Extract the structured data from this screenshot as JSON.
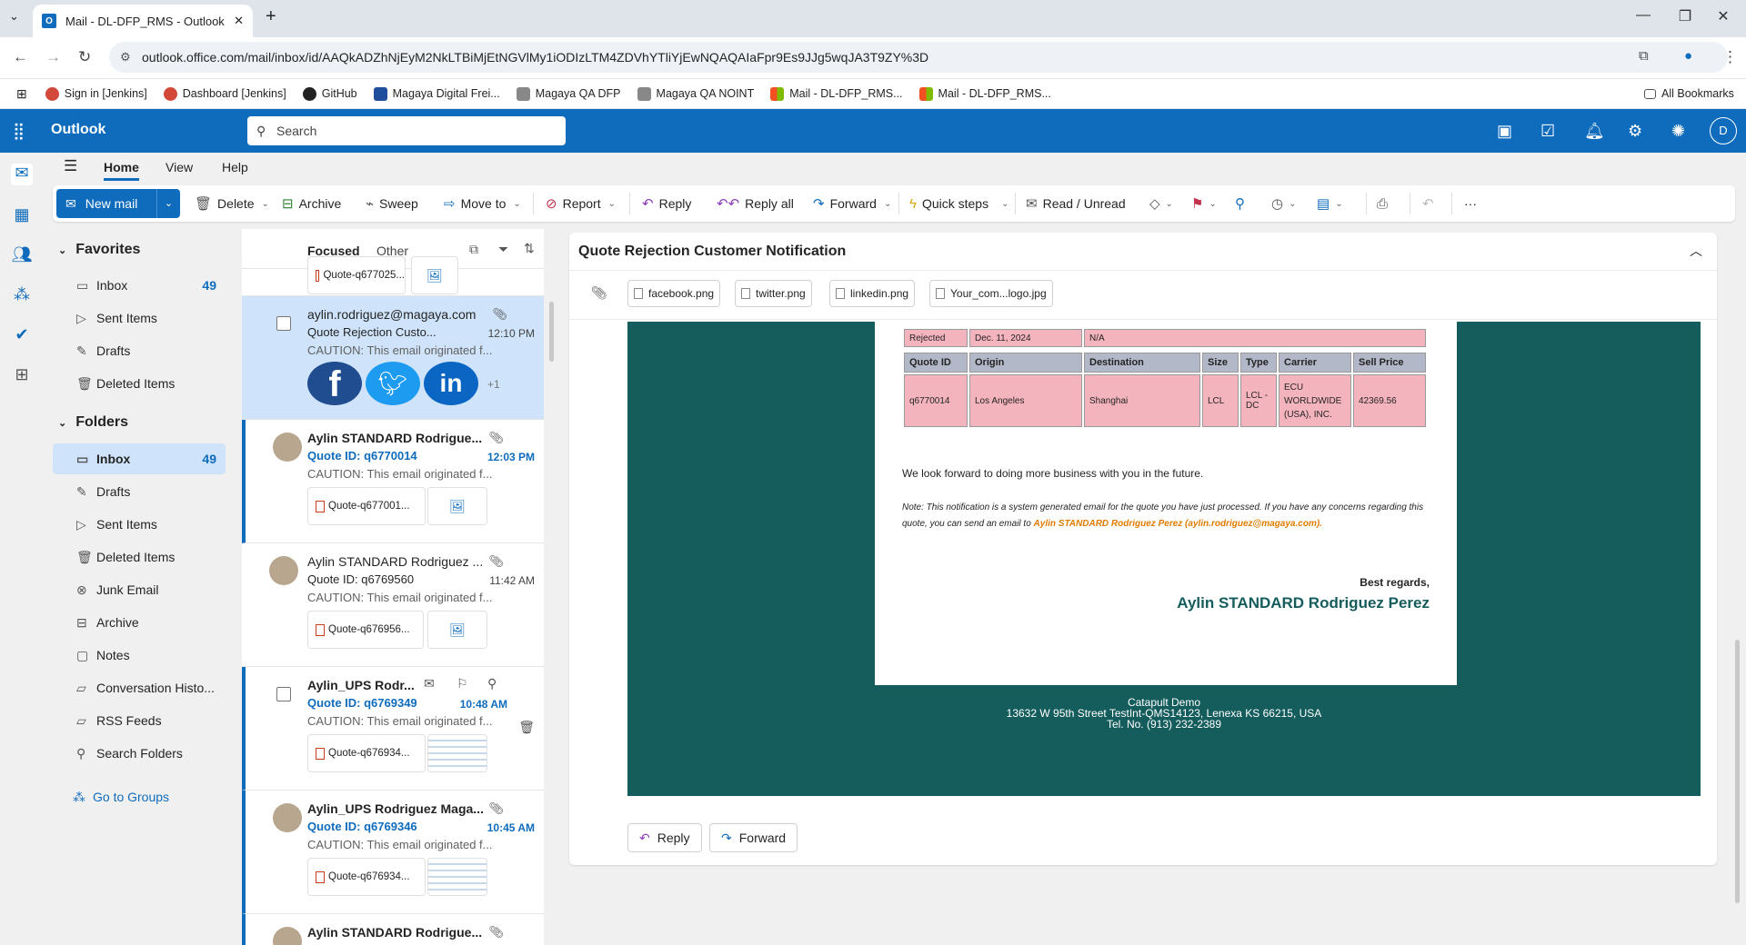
{
  "browser": {
    "tab_title": "Mail - DL-DFP_RMS - Outlook",
    "url": "outlook.office.com/mail/inbox/id/AAQkADZhNjEyM2NkLTBiMjEtNGVlMy1iODIzLTM4ZDVhYTliYjEwNQAQAIaFpr9Es9JJg5wqJA3T9ZY%3D",
    "bookmarks": [
      "Sign in [Jenkins]",
      "Dashboard [Jenkins]",
      "GitHub",
      "Magaya Digital Frei...",
      "Magaya QA DFP",
      "Magaya QA NOINT",
      "Mail - DL-DFP_RMS...",
      "Mail - DL-DFP_RMS..."
    ],
    "all_bookmarks": "All Bookmarks"
  },
  "header": {
    "brand": "Outlook",
    "search_placeholder": "Search",
    "avatar_initial": "D"
  },
  "ribbon": {
    "tabs": [
      "Home",
      "View",
      "Help"
    ],
    "new_mail": "New mail",
    "delete": "Delete",
    "archive": "Archive",
    "sweep": "Sweep",
    "move_to": "Move to",
    "report": "Report",
    "reply": "Reply",
    "reply_all": "Reply all",
    "forward": "Forward",
    "quick_steps": "Quick steps",
    "read_unread": "Read / Unread",
    "more": "···"
  },
  "folders": {
    "favorites_title": "Favorites",
    "favorites": [
      {
        "label": "Inbox",
        "count": "49"
      },
      {
        "label": "Sent Items",
        "count": ""
      },
      {
        "label": "Drafts",
        "count": ""
      },
      {
        "label": "Deleted Items",
        "count": ""
      }
    ],
    "folders_title": "Folders",
    "items": [
      {
        "label": "Inbox",
        "count": "49"
      },
      {
        "label": "Drafts",
        "count": ""
      },
      {
        "label": "Sent Items",
        "count": ""
      },
      {
        "label": "Deleted Items",
        "count": ""
      },
      {
        "label": "Junk Email",
        "count": ""
      },
      {
        "label": "Archive",
        "count": ""
      },
      {
        "label": "Notes",
        "count": ""
      },
      {
        "label": "Conversation Histo...",
        "count": ""
      },
      {
        "label": "RSS Feeds",
        "count": ""
      },
      {
        "label": "Search Folders",
        "count": ""
      }
    ],
    "go_to_groups": "Go to Groups"
  },
  "message_list": {
    "focused": "Focused",
    "other": "Other",
    "top_partial_attachment": "Quote-q677025...",
    "messages": [
      {
        "from": "aylin.rodriguez@magaya.com",
        "subject": "Quote Rejection Custo...",
        "time": "12:10 PM",
        "preview": "CAUTION: This email originated f...",
        "attachment": "",
        "more": "+1"
      },
      {
        "from": "Aylin STANDARD Rodrigue...",
        "subject": "Quote ID: q6770014",
        "time": "12:03 PM",
        "preview": "CAUTION: This email originated f...",
        "attachment": "Quote-q677001..."
      },
      {
        "from": "Aylin STANDARD Rodriguez ...",
        "subject": "Quote ID: q6769560",
        "time": "11:42 AM",
        "preview": "CAUTION: This email originated f...",
        "attachment": "Quote-q676956..."
      },
      {
        "from": "Aylin_UPS Rodr...",
        "subject": "Quote ID: q6769349",
        "time": "10:48 AM",
        "preview": "CAUTION: This email originated f...",
        "attachment": "Quote-q676934..."
      },
      {
        "from": "Aylin_UPS Rodriguez Maga...",
        "subject": "Quote ID: q6769346",
        "time": "10:45 AM",
        "preview": "CAUTION: This email originated f...",
        "attachment": "Quote-q676934..."
      },
      {
        "from": "Aylin STANDARD Rodrigue...",
        "subject": "",
        "time": "",
        "preview": "",
        "attachment": ""
      }
    ]
  },
  "reading": {
    "subject": "Quote Rejection Customer Notification",
    "attachments": [
      "facebook.png",
      "twitter.png",
      "linkedin.png",
      "Your_com...logo.jpg"
    ],
    "status_row": [
      "Rejected",
      "Dec. 11, 2024",
      "N/A"
    ],
    "table_headers": [
      "Quote ID",
      "Origin",
      "Destination",
      "Size",
      "Type",
      "Carrier",
      "Sell Price"
    ],
    "table_row": [
      "q6770014",
      "Los Angeles",
      "Shanghai",
      "LCL",
      "LCL - DC",
      "ECU WORLDWIDE (USA), INC.",
      "42369.56"
    ],
    "closing_line": "We look forward to doing more business with you in the future.",
    "note_text": "Note: This notification is a system generated email for the quote you have just processed. If you have any concerns regarding this quote, you can send an email to",
    "note_contact": "Aylin STANDARD Rodriguez Perez (aylin.rodriguez@magaya.com).",
    "regards": "Best regards,",
    "signature": "Aylin STANDARD Rodriguez Perez",
    "footer_company": "Catapult Demo",
    "footer_address": "13632 W 95th Street TestInt-QMS14123, Lenexa KS 66215, USA",
    "footer_phone": "Tel. No. (913) 232-2389",
    "reply": "Reply",
    "forward": "Forward"
  }
}
